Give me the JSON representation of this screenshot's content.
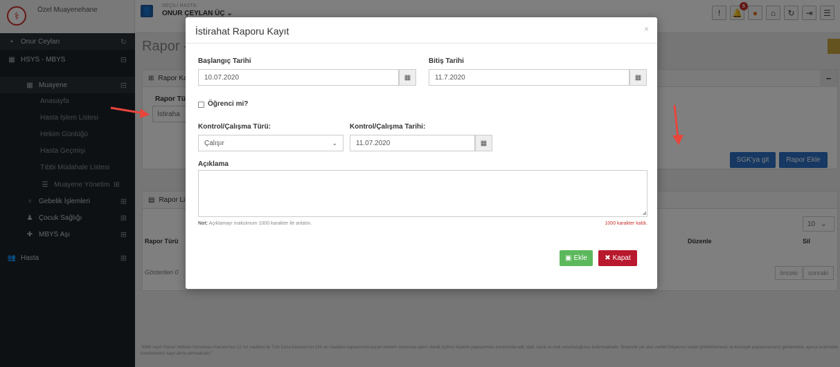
{
  "header": {
    "brand_title": "Özel Muayenehane",
    "patient_caption": "SEÇİLİ HASTA:",
    "patient_name": "ONUR ÇEYLAN ÜÇ ⌄",
    "notification_count": "5"
  },
  "sidebar": {
    "user": "Onur Ceylan",
    "system": "HSYS - MBYS",
    "exam_group": "Muayene",
    "items": [
      "Anasayfa",
      "Hasta İşlem Listesi",
      "Hekim Günlüğü",
      "Hasta Geçmişi",
      "Tıbbi Müdahale Listesi",
      "Muayene Yönetim"
    ],
    "groups": [
      "Gebelik İşlemleri",
      "Çocuk Sağlığı",
      "MBYS Aşı"
    ],
    "patient_section": "Hasta"
  },
  "background": {
    "page_title": "Rapor - [",
    "panel1_title": "Rapor Ka",
    "report_type_label": "Rapor Tür",
    "report_type_value": "İstiraha",
    "sgk_button": "SGK'ya git",
    "add_report_button": "Rapor Ekle",
    "panel2_title": "Rapor Li",
    "page_size": "10",
    "col_report_type": "Rapor Türü",
    "col_edit": "Düzenle",
    "col_delete": "Sil",
    "showing_text": "Gösterilen 0",
    "prev": "önceki",
    "next": "sonraki",
    "footer_note": "\"6698 sayılı Kişisel Verilerin Korunması Kanunu'nun 12 nci maddesi ile Türk Ceza Kanunu'nun 136 ncı maddesi kapsamında kişisel verilerin mevzuata aykırı olarak üçüncü kişilerle paylaşılması durumunda adli, idari, cezai ve mali sorumluluğunuz bulunmaktadır. Sistemde yer alan verileri ihtiyacınız kadar görüntülemeniz ve kimseyle paylaşmamanız gerekmekte, ayrıca sistemdeki hareketleriniz kayıt altına alınmaktadır.\""
  },
  "modal": {
    "title": "İstirahat Raporu Kayıt",
    "start_label": "Başlangıç Tarihi",
    "start_value": "10.07.2020",
    "end_label": "Bitiş Tarihi",
    "end_value": "11.7.2020",
    "student_label": "Öğrenci mi?",
    "control_type_label": "Kontrol/Çalışma Türü:",
    "control_type_value": "Çalışır",
    "control_date_label": "Kontrol/Çalışma Tarihi:",
    "control_date_value": "11.07.2020",
    "description_label": "Açıklama",
    "note_prefix": "Not:",
    "note_text": " Açıklamayı maksimum 1000 karakter ile anlatın.",
    "chars_left": "1000 karakter kaldı.",
    "add_button": "Ekle",
    "close_button": "Kapat"
  },
  "colors": {
    "accent_blue": "#2d71c4",
    "danger_red": "#b8192e",
    "success_green": "#5cb85c",
    "sidebar_bg": "#1d2328",
    "annotation_arrow": "#e8453c"
  },
  "icons": [
    "brand-logo-icon",
    "patient-icon",
    "alert-icon",
    "bell-icon",
    "lightbulb-icon",
    "home-icon",
    "refresh-icon",
    "logout-icon",
    "menu-icon",
    "calendar-icon",
    "chevron-down-icon",
    "save-icon",
    "close-icon"
  ]
}
